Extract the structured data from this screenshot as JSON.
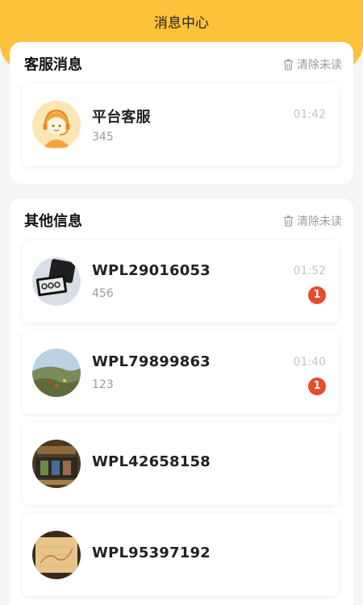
{
  "header": {
    "title": "消息中心"
  },
  "service_section": {
    "title": "客服消息",
    "clear_label": "清除未读",
    "items": [
      {
        "name": "平台客服",
        "preview": "345",
        "time": "01:42"
      }
    ]
  },
  "other_section": {
    "title": "其他信息",
    "clear_label": "清除未读",
    "items": [
      {
        "name": "WPL29016053",
        "preview": "456",
        "time": "01:52",
        "badge": "1",
        "avatar_icon": "game-console-thumbnail"
      },
      {
        "name": "WPL79899863",
        "preview": "123",
        "time": "01:40",
        "badge": "1",
        "avatar_icon": "landscape-thumbnail"
      },
      {
        "name": "WPL42658158",
        "avatar_icon": "game-board-thumbnail"
      },
      {
        "name": "WPL95397192",
        "avatar_icon": "map-thumbnail"
      }
    ]
  },
  "colors": {
    "accent": "#fcc23a",
    "badge": "#e54b2c"
  }
}
